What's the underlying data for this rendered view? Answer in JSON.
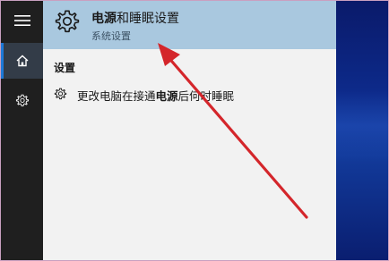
{
  "sidebar": {
    "items": [
      {
        "icon": "hamburger-menu-icon"
      },
      {
        "icon": "home-icon"
      },
      {
        "icon": "gear-icon"
      }
    ]
  },
  "best_match": {
    "title_pre": "电源",
    "title_post": "和睡眠设置",
    "subtitle": "系统设置"
  },
  "settings_section": {
    "heading": "设置",
    "results": [
      {
        "pre": "更改电脑在接通",
        "highlight": "电源",
        "post": "后何时睡眠"
      }
    ]
  },
  "colors": {
    "sidebar": "#1f1f1f",
    "panel": "#f2f2f2",
    "best_match_highlight": "#a9c8df",
    "arrow": "#d4262b",
    "desktop": "#0d2a8a"
  }
}
